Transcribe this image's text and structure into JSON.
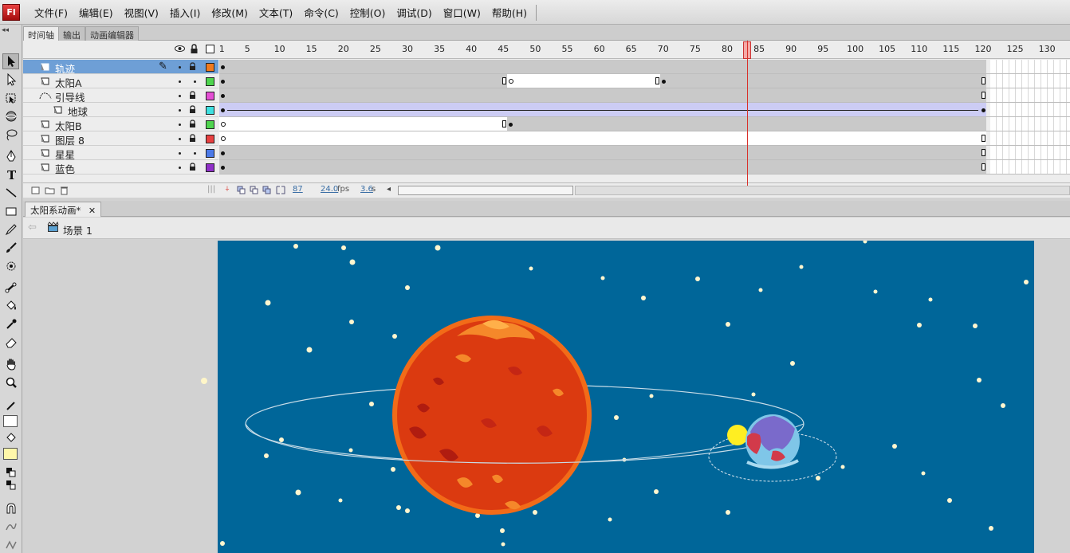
{
  "app": {
    "logo_text": "Fl"
  },
  "menubar": {
    "items": [
      "文件(F)",
      "编辑(E)",
      "视图(V)",
      "插入(I)",
      "修改(M)",
      "文本(T)",
      "命令(C)",
      "控制(O)",
      "调试(D)",
      "窗口(W)",
      "帮助(H)"
    ]
  },
  "panel_tabs": [
    "时间轴",
    "输出",
    "动画编辑器"
  ],
  "timeline": {
    "ruler_labels": [
      "1",
      "5",
      "10",
      "15",
      "20",
      "25",
      "30",
      "35",
      "40",
      "45",
      "50",
      "55",
      "60",
      "65",
      "70",
      "75",
      "80",
      "85",
      "90",
      "95",
      "100",
      "105",
      "110",
      "115",
      "120",
      "125",
      "130"
    ],
    "current_frame": "87",
    "fps": "24.0",
    "fps_unit": "fps",
    "time": "3.6",
    "time_unit": "s",
    "layers": [
      {
        "name": "轨迹",
        "selected": true,
        "type": "normal",
        "color": "#f07a1e"
      },
      {
        "name": "太阳A",
        "selected": false,
        "type": "normal",
        "color": "#4ed44e"
      },
      {
        "name": "引导线",
        "selected": false,
        "type": "guide",
        "color": "#e44ed4"
      },
      {
        "name": "地球",
        "selected": false,
        "type": "guided",
        "color": "#3ee0e0"
      },
      {
        "name": "太阳B",
        "selected": false,
        "type": "normal",
        "color": "#4ed44e"
      },
      {
        "name": "图层 8",
        "selected": false,
        "type": "normal",
        "color": "#e84040"
      },
      {
        "name": "星星",
        "selected": false,
        "type": "normal",
        "color": "#4c7ae8"
      },
      {
        "name": "蓝色",
        "selected": false,
        "type": "normal",
        "color": "#9030c8"
      }
    ]
  },
  "document": {
    "tab_title": "太阳系动画*",
    "scene_label": "场景 1"
  },
  "stage": {
    "background": "#006699",
    "sun_color": "#db3a10",
    "sun_rim": "#f26b18",
    "earth_color": "#7fc6e8",
    "moon_color": "#ffee22"
  }
}
